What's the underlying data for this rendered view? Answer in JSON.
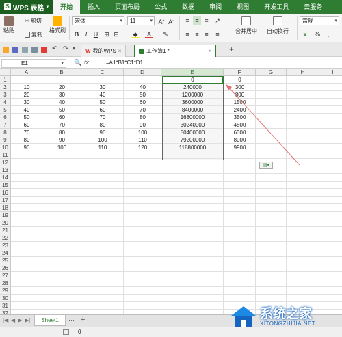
{
  "app": {
    "name": "WPS 表格"
  },
  "menu": [
    "开始",
    "插入",
    "页面布局",
    "公式",
    "数据",
    "审阅",
    "视图",
    "开发工具",
    "云服务"
  ],
  "ribbon": {
    "paste": "粘贴",
    "cut": "剪切",
    "copy": "复制",
    "format_painter": "格式刷",
    "font_name": "宋体",
    "font_size": "11",
    "merge_center": "合并居中",
    "wrap_text": "自动换行",
    "number_format": "常规",
    "percent": "%"
  },
  "doc_tabs": [
    {
      "label": "我的WPS"
    },
    {
      "label": "工作簿1 *"
    }
  ],
  "formula_bar": {
    "cell_ref": "E1",
    "fx": "fx",
    "formula": "=A1*B1*C1*D1"
  },
  "columns": [
    "A",
    "B",
    "C",
    "D",
    "E",
    "F",
    "G",
    "H",
    "I"
  ],
  "rows": [
    "1",
    "2",
    "3",
    "4",
    "5",
    "6",
    "7",
    "8",
    "9",
    "10",
    "11",
    "12",
    "13",
    "14",
    "15",
    "16",
    "17",
    "18",
    "19",
    "20",
    "21",
    "22",
    "23",
    "24",
    "25",
    "26",
    "27",
    "28",
    "29",
    "30",
    "31",
    "32"
  ],
  "cells": [
    [
      "",
      "",
      "",
      "",
      "0",
      "0"
    ],
    [
      "10",
      "20",
      "30",
      "40",
      "240000",
      "300"
    ],
    [
      "20",
      "30",
      "40",
      "50",
      "1200000",
      "800"
    ],
    [
      "30",
      "40",
      "50",
      "60",
      "3600000",
      "1500"
    ],
    [
      "40",
      "50",
      "60",
      "70",
      "8400000",
      "2400"
    ],
    [
      "50",
      "60",
      "70",
      "80",
      "16800000",
      "3500"
    ],
    [
      "60",
      "70",
      "80",
      "90",
      "30240000",
      "4800"
    ],
    [
      "70",
      "80",
      "90",
      "100",
      "50400000",
      "6300"
    ],
    [
      "80",
      "90",
      "100",
      "110",
      "79200000",
      "8000"
    ],
    [
      "90",
      "100",
      "110",
      "120",
      "118800000",
      "9900"
    ]
  ],
  "sheets": [
    {
      "label": "Sheet1"
    }
  ],
  "sheet_bar": {
    "menu": "···",
    "add": "+"
  },
  "status": {
    "value": "0"
  },
  "watermark": {
    "title": "系统之家",
    "url": "XITONGZHIJIA.NET"
  },
  "colors": {
    "accent": "#2e7d32",
    "arrow": "#e57373"
  }
}
